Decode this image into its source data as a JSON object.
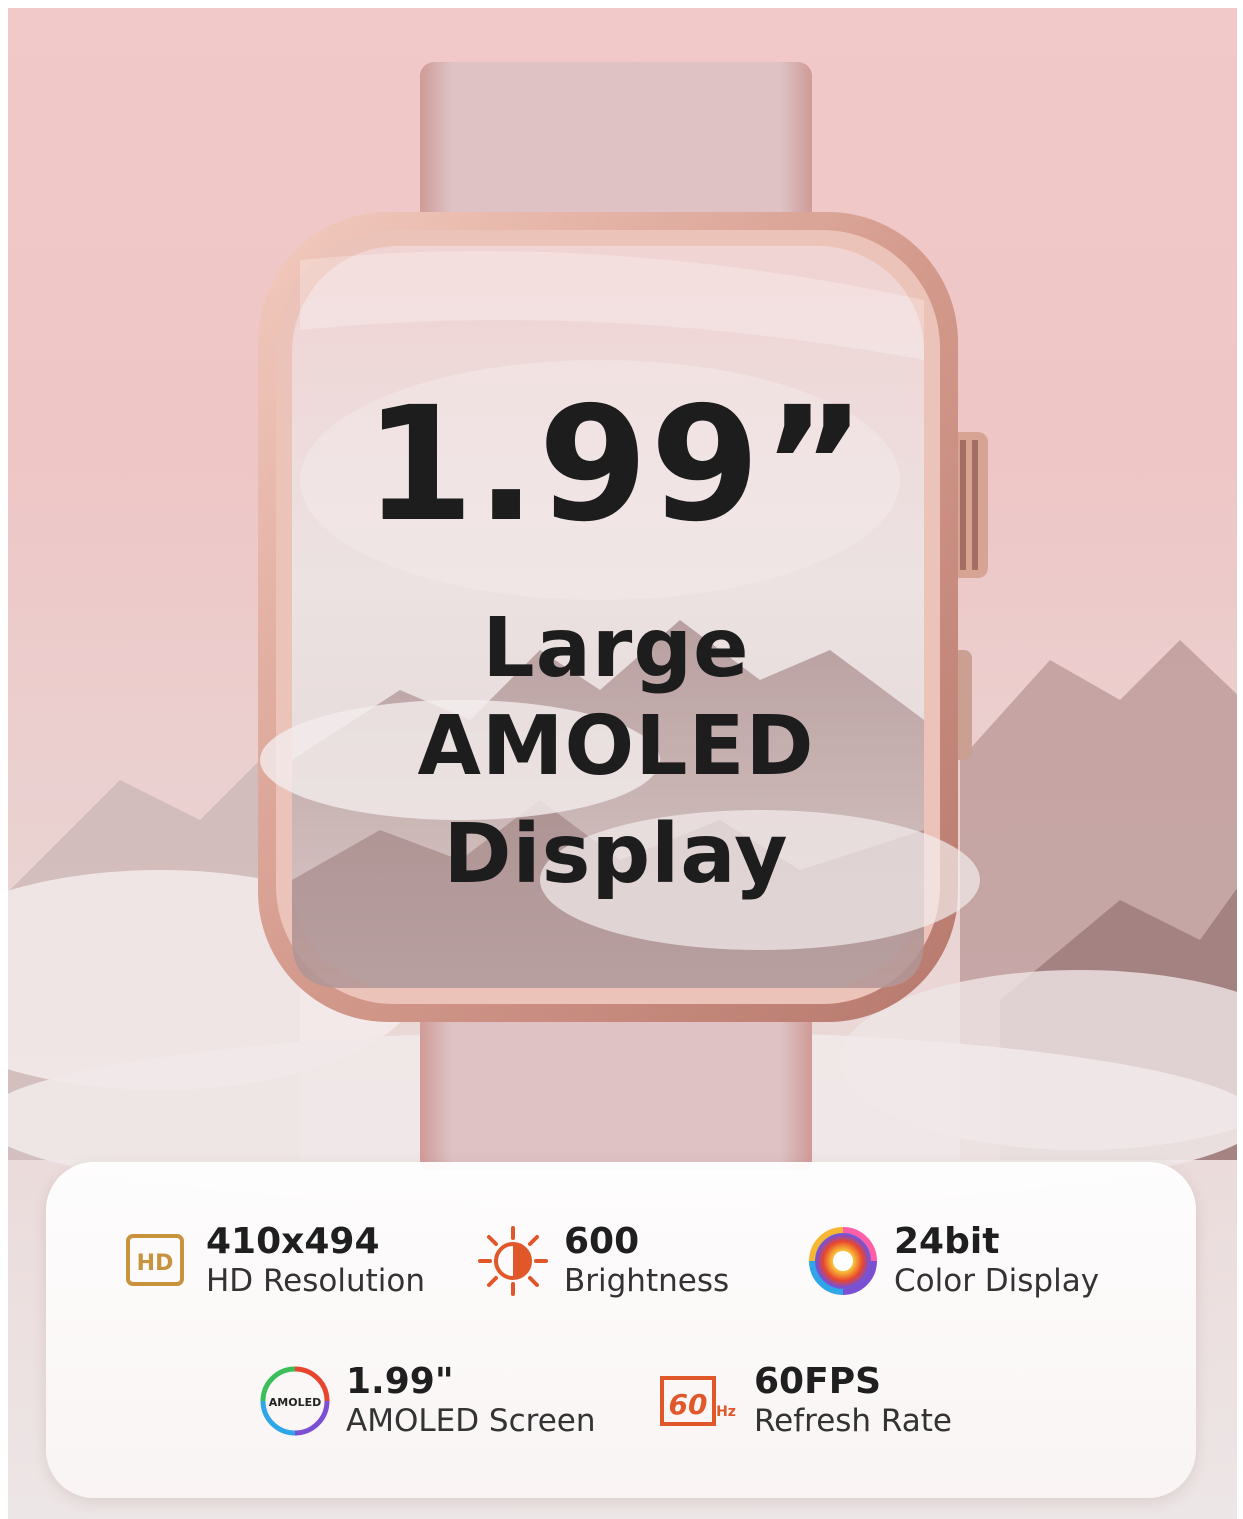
{
  "headline": {
    "size": "1.99”",
    "line1": "Large",
    "line2": "AMOLED",
    "line3": "Display"
  },
  "features": [
    {
      "icon": "hd-icon",
      "value": "410x494",
      "label": "HD Resolution",
      "icon_text": "HD"
    },
    {
      "icon": "brightness-icon",
      "value": "600",
      "label": "Brightness"
    },
    {
      "icon": "color-swirl-icon",
      "value": "24bit",
      "label": "Color Display"
    },
    {
      "icon": "amoled-icon",
      "value": "1.99\"",
      "label": "AMOLED Screen",
      "icon_text": "AMOLED"
    },
    {
      "icon": "refresh-60hz-icon",
      "value": "60FPS",
      "label": "Refresh Rate",
      "icon_text": "60",
      "icon_unit": "Hz"
    }
  ],
  "colors": {
    "background_pink": "#f1c9c8",
    "watch_case": "#d9a79b",
    "strap": "#dcc0c2",
    "text_dark": "#1d1d1d",
    "accent_orange": "#e0582a",
    "hd_gold": "#c8933e"
  }
}
